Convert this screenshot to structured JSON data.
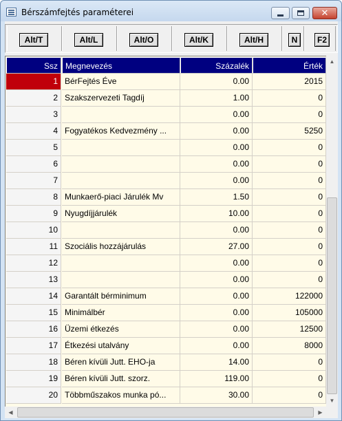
{
  "window": {
    "title": "Bérszámfejtés paraméterei",
    "close_glyph": "✕"
  },
  "toolbar": {
    "buttons": [
      "Alt/T",
      "Alt/L",
      "Alt/O",
      "Alt/K",
      "Alt/H",
      "N",
      "F2"
    ]
  },
  "table": {
    "columns": [
      "Ssz",
      "Megnevezés",
      "Százalék",
      "Érték"
    ],
    "selected_row": 1,
    "rows": [
      {
        "ssz": "1",
        "name": "BérFejtés Éve",
        "pct": "0.00",
        "value": "2015"
      },
      {
        "ssz": "2",
        "name": "Szakszervezeti Tagdíj",
        "pct": "1.00",
        "value": "0"
      },
      {
        "ssz": "3",
        "name": "",
        "pct": "0.00",
        "value": "0"
      },
      {
        "ssz": "4",
        "name": "Fogyatékos Kedvezmény ...",
        "pct": "0.00",
        "value": "5250"
      },
      {
        "ssz": "5",
        "name": "",
        "pct": "0.00",
        "value": "0"
      },
      {
        "ssz": "6",
        "name": "",
        "pct": "0.00",
        "value": "0"
      },
      {
        "ssz": "7",
        "name": "",
        "pct": "0.00",
        "value": "0"
      },
      {
        "ssz": "8",
        "name": "Munkaerő-piaci Járulék Mv",
        "pct": "1.50",
        "value": "0"
      },
      {
        "ssz": "9",
        "name": "Nyugdíjjárulék",
        "pct": "10.00",
        "value": "0"
      },
      {
        "ssz": "10",
        "name": "",
        "pct": "0.00",
        "value": "0"
      },
      {
        "ssz": "11",
        "name": "Szociális hozzájárulás",
        "pct": "27.00",
        "value": "0"
      },
      {
        "ssz": "12",
        "name": "",
        "pct": "0.00",
        "value": "0"
      },
      {
        "ssz": "13",
        "name": "",
        "pct": "0.00",
        "value": "0"
      },
      {
        "ssz": "14",
        "name": "Garantált bérminimum",
        "pct": "0.00",
        "value": "122000"
      },
      {
        "ssz": "15",
        "name": "Minimálbér",
        "pct": "0.00",
        "value": "105000"
      },
      {
        "ssz": "16",
        "name": "Üzemi étkezés",
        "pct": "0.00",
        "value": "12500"
      },
      {
        "ssz": "17",
        "name": "Étkezési utalvány",
        "pct": "0.00",
        "value": "8000"
      },
      {
        "ssz": "18",
        "name": "Béren kívüli Jutt. EHO-ja",
        "pct": "14.00",
        "value": "0"
      },
      {
        "ssz": "19",
        "name": "Béren kívüli Jutt. szorz.",
        "pct": "119.00",
        "value": "0"
      },
      {
        "ssz": "20",
        "name": "Többműszakos munka pó...",
        "pct": "30.00",
        "value": "0"
      }
    ]
  }
}
